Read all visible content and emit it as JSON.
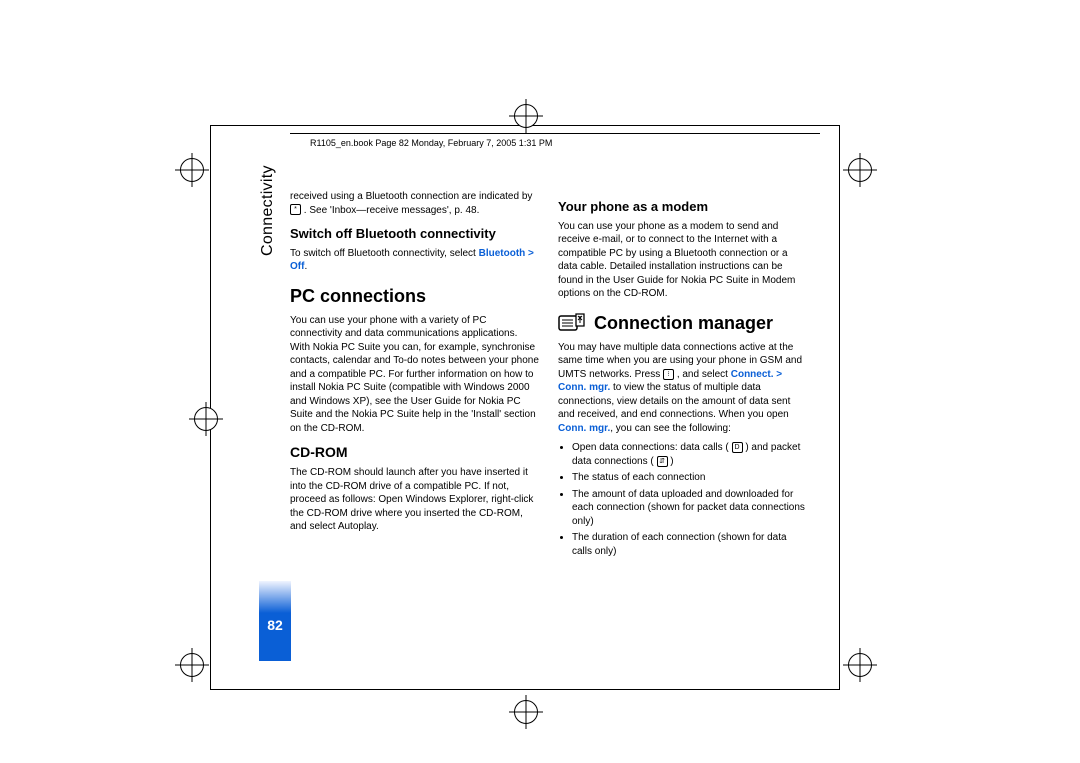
{
  "header": "R1105_en.book  Page 82  Monday, February 7, 2005  1:31 PM",
  "side_label": "Connectivity",
  "page_number": "82",
  "left": {
    "p1": "received using a Bluetooth connection are indicated by ",
    "p1b": ". See 'Inbox—receive messages', p. 48.",
    "h_switch": "Switch off Bluetooth connectivity",
    "p2a": "To switch off Bluetooth connectivity, select ",
    "p2b": "Bluetooth > Off",
    "p2c": ".",
    "h_pc": "PC connections",
    "p3": "You can use your phone with a variety of PC connectivity and data communications applications. With Nokia PC Suite you can, for example, synchronise contacts, calendar and To-do notes between your phone and a compatible PC. For further information on how to install Nokia PC Suite (compatible with Windows 2000 and Windows XP), see the User Guide for Nokia PC Suite and the Nokia PC Suite help in the 'Install' section on the CD-ROM.",
    "h_cd": "CD-ROM",
    "p4": "The CD-ROM should launch after you have inserted it into the CD-ROM drive of a compatible PC. If not, proceed as follows: Open Windows Explorer, right-click the CD-ROM drive where you inserted the CD-ROM, and select Autoplay."
  },
  "right": {
    "h_modem": "Your phone as a modem",
    "p1": "You can use your phone as a modem to send and receive e-mail, or to connect to the Internet with a compatible PC by using a Bluetooth connection or a data cable. Detailed installation instructions can be found in the User Guide for Nokia PC Suite in Modem options on the CD-ROM.",
    "h_conn": "Connection manager",
    "p2a": "You may have multiple data connections active at the same time when you are using your phone in GSM and UMTS networks. Press ",
    "p2b": " , and select ",
    "p2c": "Connect. > Conn. mgr.",
    "p2d": " to view the status of multiple data connections, view details on the amount of data sent and received, and end connections. When you open ",
    "p2e": "Conn. mgr.",
    "p2f": ", you can see the following:",
    "li1a": "Open data connections: data calls (",
    "li1b": ") and packet data connections (",
    "li1c": ")",
    "li2": "The status of each connection",
    "li3": "The amount of data uploaded and downloaded for each connection (shown for packet data connections only)",
    "li4": "The duration of each connection (shown for data calls only)"
  }
}
